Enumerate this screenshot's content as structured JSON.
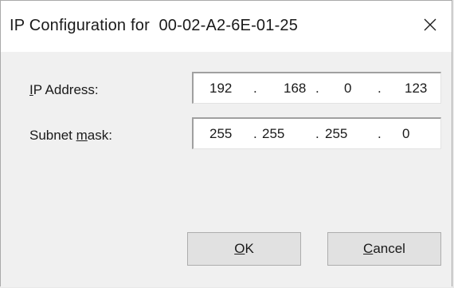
{
  "dialog": {
    "title": "IP Configuration for  00-02-A2-6E-01-25",
    "close_icon": "close-icon"
  },
  "ip_address": {
    "label_hotkey": "I",
    "label_rest": "P Address:",
    "octets": [
      "192",
      "168",
      "0",
      "123"
    ],
    "separator": "."
  },
  "subnet_mask": {
    "label_pre": "Subnet ",
    "label_hotkey": "m",
    "label_rest": "ask:",
    "octets": [
      "255",
      "255",
      "255",
      "0"
    ],
    "separator": "."
  },
  "buttons": {
    "ok_hotkey": "O",
    "ok_rest": "K",
    "cancel_hotkey": "C",
    "cancel_rest": "ancel"
  }
}
